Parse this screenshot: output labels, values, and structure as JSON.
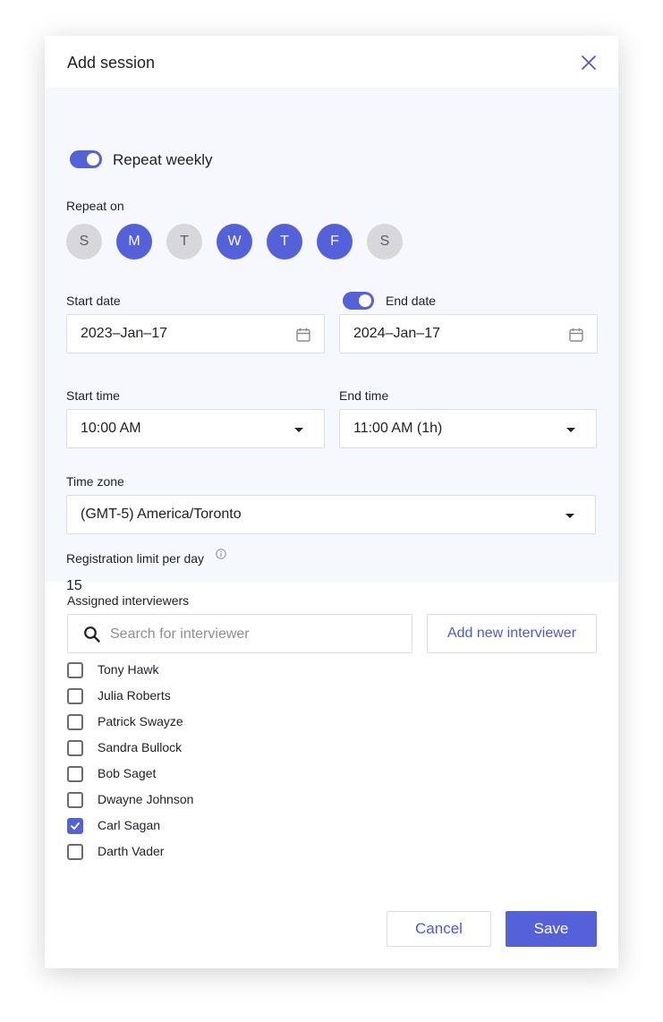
{
  "dialog": {
    "title": "Add session",
    "close_icon": "close-icon"
  },
  "repeat": {
    "toggle_label": "Repeat weekly",
    "toggle_on": true,
    "repeat_on_label": "Repeat on",
    "days": [
      {
        "letter": "S",
        "selected": false
      },
      {
        "letter": "M",
        "selected": true
      },
      {
        "letter": "T",
        "selected": false
      },
      {
        "letter": "W",
        "selected": true
      },
      {
        "letter": "T",
        "selected": true
      },
      {
        "letter": "F",
        "selected": true
      },
      {
        "letter": "S",
        "selected": false
      }
    ]
  },
  "dates": {
    "start_label": "Start date",
    "start_value": "2023–Jan–17",
    "end_label": "End date",
    "end_toggle_on": true,
    "end_value": "2024–Jan–17",
    "calendar_icon": "calendar-icon"
  },
  "times": {
    "start_label": "Start time",
    "start_value": "10:00 AM",
    "end_label": "End time",
    "end_value": "11:00 AM (1h)"
  },
  "timezone": {
    "label": "Time zone",
    "value": "(GMT-5) America/Toronto"
  },
  "registration": {
    "label": "Registration limit per day",
    "info_icon": "info-icon",
    "value": "15"
  },
  "interviewers": {
    "label": "Assigned interviewers",
    "search_placeholder": "Search for interviewer",
    "search_value": "",
    "add_button": "Add new interviewer",
    "list": [
      {
        "name": "Tony Hawk",
        "checked": false
      },
      {
        "name": "Julia Roberts",
        "checked": false
      },
      {
        "name": "Patrick Swayze",
        "checked": false
      },
      {
        "name": "Sandra Bullock",
        "checked": false
      },
      {
        "name": "Bob Saget",
        "checked": false
      },
      {
        "name": "Dwayne Johnson",
        "checked": false
      },
      {
        "name": "Carl Sagan",
        "checked": true
      },
      {
        "name": "Darth Vader",
        "checked": false
      }
    ]
  },
  "footer": {
    "cancel_label": "Cancel",
    "save_label": "Save"
  },
  "colors": {
    "accent": "#5461d8",
    "settings_background": "#f6f8fd",
    "day_unselected": "#d8d8db"
  }
}
